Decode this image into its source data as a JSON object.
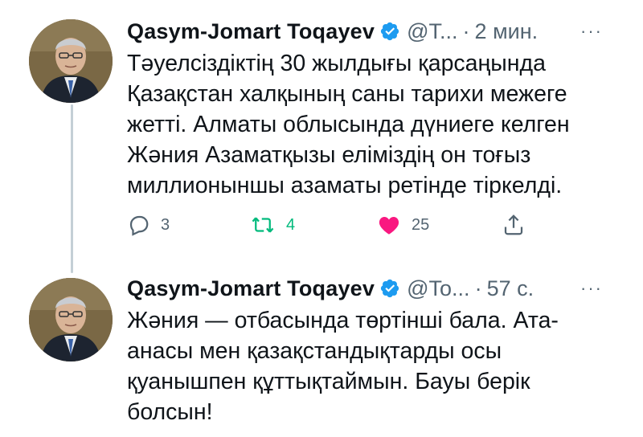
{
  "tweets": [
    {
      "author_name": "Qasym-Jomart Toqayev",
      "handle": "@T...",
      "dot": "·",
      "time": "2 мин.",
      "more": "···",
      "text": "Тәуелсіздіктің 30 жылдығы қарсаңында\nҚазақстан халқының саны тарихи межеге\nжетті. Алматы облысында дүниеге келген\nЖәния Азаматқызы еліміздің он тоғыз\nмиллионыншы азаматы ретінде тіркелді.",
      "reply_count": "3",
      "retweet_count": "4",
      "like_count": "25"
    },
    {
      "author_name": "Qasym-Jomart Toqayev",
      "handle": "@To...",
      "dot": "·",
      "time": "57 с.",
      "more": "···",
      "text": "Жәния — отбасында төртінші бала. Ата-\nанасы мен қазақстандықтарды осы\nқуанышпен құттықтаймын. Бауы берік\nболсын!"
    }
  ],
  "icons": {
    "verified": "verified-badge-icon",
    "reply": "reply-icon",
    "retweet": "retweet-icon",
    "like": "heart-icon",
    "share": "share-icon"
  },
  "colors": {
    "verified": "#1d9bf0",
    "retweet": "#00ba7c",
    "like": "#f91880",
    "muted": "#536471",
    "thread_line": "#c4cfd6"
  }
}
